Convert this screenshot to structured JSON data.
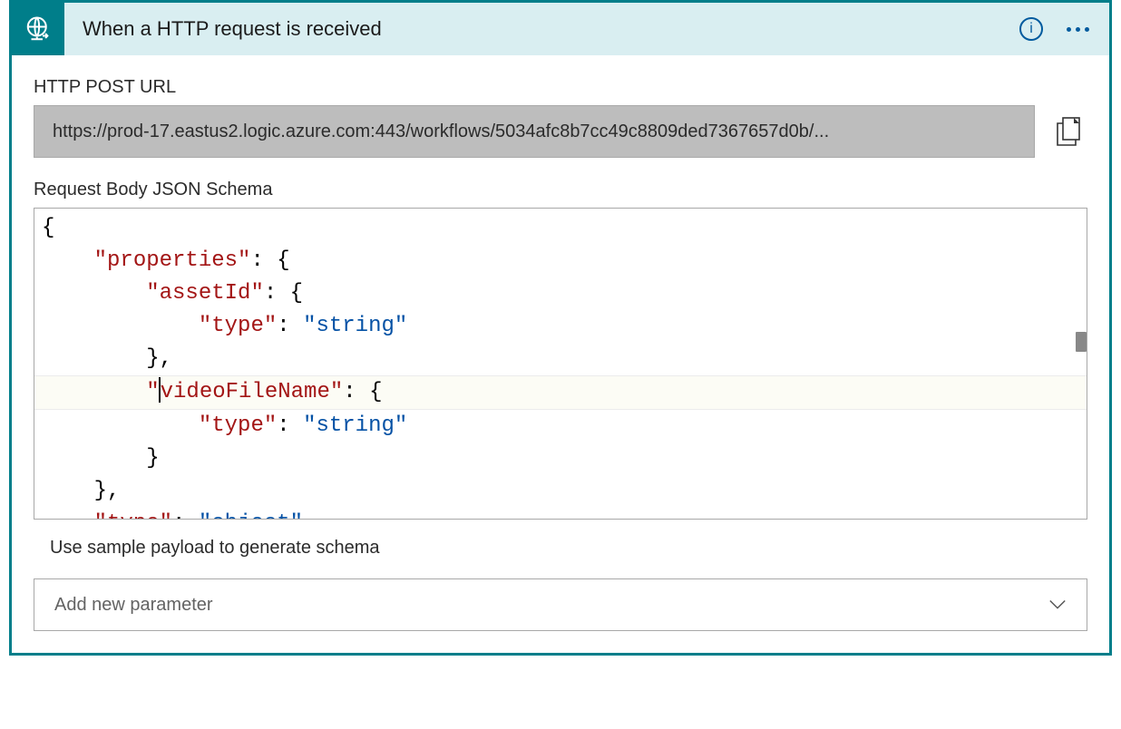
{
  "header": {
    "title": "When a HTTP request is received",
    "icon": "globe-arrow-icon"
  },
  "sections": {
    "url_label": "HTTP POST URL",
    "url_value": "https://prod-17.eastus2.logic.azure.com:443/workflows/5034afc8b7cc49c8809ded7367657d0b/...",
    "schema_label": "Request Body JSON Schema",
    "generate_link": "Use sample payload to generate schema",
    "add_param_placeholder": "Add new parameter"
  },
  "schema_tokens": {
    "l0": "{",
    "l1_key": "\"properties\"",
    "l1_rest": ": {",
    "l2_key": "\"assetId\"",
    "l2_rest": ": {",
    "l3_key": "\"type\"",
    "l3_mid": ": ",
    "l3_val": "\"string\"",
    "l4": "},",
    "l5_key": "\"videoFileName\"",
    "l5_rest": ": {",
    "l6_key": "\"type\"",
    "l6_mid": ": ",
    "l6_val": "\"string\"",
    "l7": "}",
    "l8": "},",
    "l9_key": "\"type\"",
    "l9_mid": ": ",
    "l9_val": "\"object\""
  },
  "schema_json": {
    "properties": {
      "assetId": {
        "type": "string"
      },
      "videoFileName": {
        "type": "string"
      }
    },
    "type": "object"
  }
}
